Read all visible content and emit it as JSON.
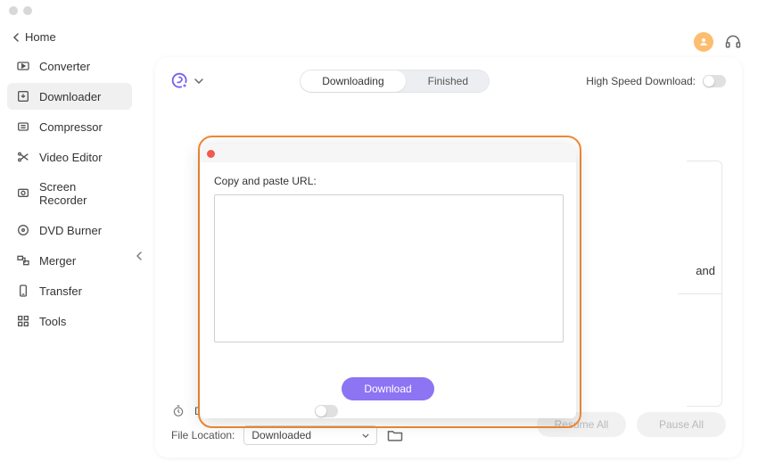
{
  "sidebar": {
    "home": "Home",
    "items": [
      {
        "label": "Converter"
      },
      {
        "label": "Downloader"
      },
      {
        "label": "Compressor"
      },
      {
        "label": "Video Editor"
      },
      {
        "label": "Screen Recorder"
      },
      {
        "label": "DVD Burner"
      },
      {
        "label": "Merger"
      },
      {
        "label": "Transfer"
      },
      {
        "label": "Tools"
      }
    ]
  },
  "toolbar": {
    "tabs": {
      "downloading": "Downloading",
      "finished": "Finished"
    },
    "high_speed_label": "High Speed Download:"
  },
  "modal": {
    "label": "Copy and paste URL:",
    "button": "Download"
  },
  "hidden": {
    "and": "and"
  },
  "footer": {
    "convert_label": "Download then Convert",
    "location_label": "File Location:",
    "location_value": "Downloaded",
    "resume": "Resume All",
    "pause": "Pause All"
  }
}
